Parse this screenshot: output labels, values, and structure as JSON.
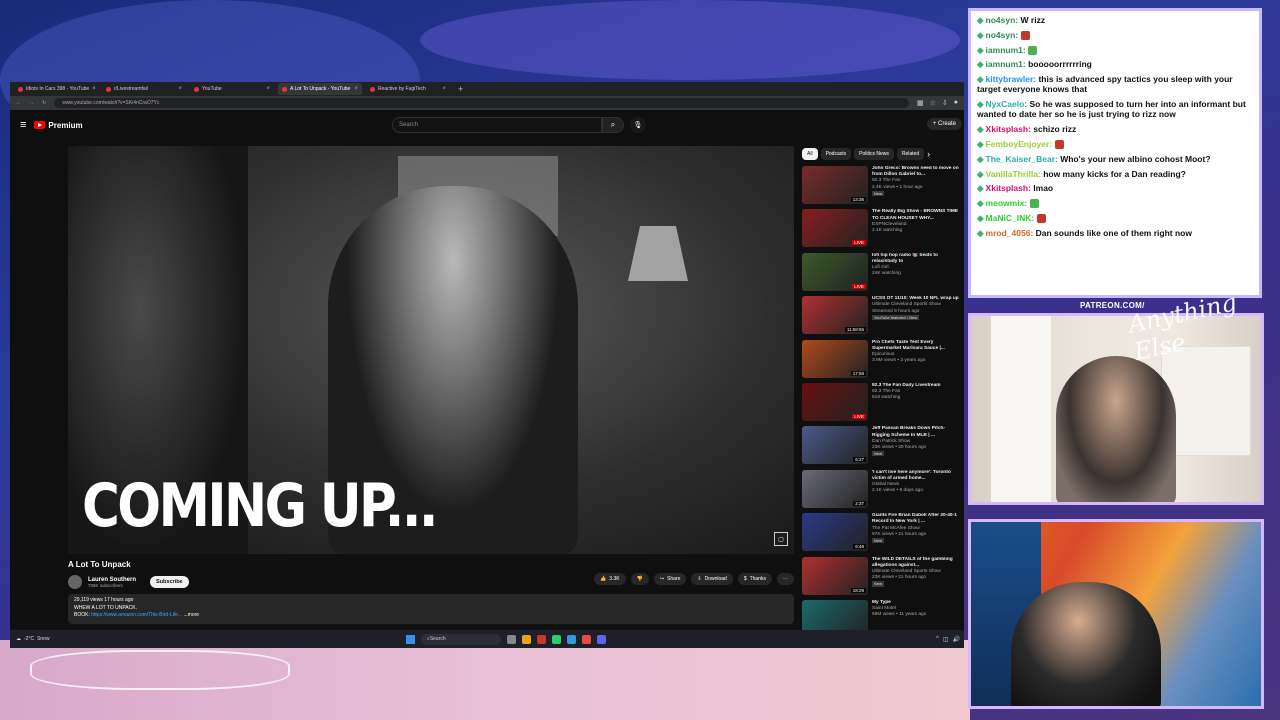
{
  "browser": {
    "tabs": [
      {
        "label": "Idiots In Cars 398 - YouTube",
        "active": false
      },
      {
        "label": "r/Livestreamfail",
        "active": false
      },
      {
        "label": "YouTube",
        "active": false
      },
      {
        "label": "A Lot To Unpack - YouTube",
        "active": true
      },
      {
        "label": "Reactive by FugiTech",
        "active": false
      }
    ],
    "url": "www.youtube.com/watch?v=SKi4nCraO7Yc"
  },
  "youtube": {
    "logo_label": "Premium",
    "search_placeholder": "Search",
    "create_label": "Create",
    "video_overlay_text": "COMING UP...",
    "title": "A Lot To Unpack",
    "channel": "Lauren Southern",
    "subscribers": "708K subscribers",
    "subscribe_label": "Subscribe",
    "likes": "3.3K",
    "share_label": "Share",
    "download_label": "Download",
    "thanks_label": "Thanks",
    "description": {
      "stats": "29,119 views  17 hours ago",
      "line1": "WHEW A LOT TO UNPACK.",
      "book_prefix": "BOOK: ",
      "book_link": "https://www.amazon.com/This-Bird-Life...",
      "more": "...more"
    },
    "chips": [
      "All",
      "Podcasts",
      "Politics News",
      "Related"
    ],
    "recommendations": [
      {
        "title": "John Greco: Browns need to move on from Dillon Gabriel to...",
        "channel": "92.3 The Fan",
        "views": "2.4K views • 1 hour ago",
        "badge": "New",
        "time": "13:36",
        "color": "#7a2a2a"
      },
      {
        "title": "The Really Big Show - BROWNS TIME TO CLEAN HOUSE? WHY...",
        "channel": "ESPNCleveland",
        "views": "2.1K watching",
        "badge": "",
        "time": "LIVE",
        "color": "#8a1e1e"
      },
      {
        "title": "lofi hip hop radio 📚 beats to relax/study to",
        "channel": "Lofi Girl",
        "views": "24K watching",
        "badge": "",
        "time": "LIVE",
        "color": "#3a5a2a"
      },
      {
        "title": "UCSS OT 11/10: Week 10 NFL wrap up",
        "channel": "Ultimate Cleveland Sports Show",
        "views": "Streamed 9 hours ago",
        "badge": "YouTube featured  •  New",
        "time": "11:58:55",
        "color": "#b03030"
      },
      {
        "title": "Pro Chefs Taste Test Every Supermarket Marinara Sauce |...",
        "channel": "Epicurious",
        "views": "3.9M views • 3 years ago",
        "badge": "",
        "time": "17:58",
        "color": "#b04a1a"
      },
      {
        "title": "92.3 The Fan Daily Livestream",
        "channel": "92.3 The Fan",
        "views": "518 watching",
        "badge": "",
        "time": "LIVE",
        "color": "#6a0f0f"
      },
      {
        "title": "Jeff Passan Breaks Down Pitch-Rigging Scheme In MLB | ...",
        "channel": "Dan Patrick Show",
        "views": "23K views • 20 hours ago",
        "badge": "New",
        "time": "6:27",
        "color": "#4a5a8a"
      },
      {
        "title": "'I can't live here anymore': Toronto victim of armed home...",
        "channel": "Global News",
        "views": "2.1K views • 6 days ago",
        "badge": "",
        "time": "2:37",
        "color": "#6a6a7a"
      },
      {
        "title": "Giants Fire Brian Daboll After 20-40-1 Record In New York | ...",
        "channel": "The Pat McAfee Show",
        "views": "97K views • 21 hours ago",
        "badge": "New",
        "time": "6:48",
        "color": "#2a3a8a"
      },
      {
        "title": "The WILD DETAILS of the gambling allegations against...",
        "channel": "Ultimate Cleveland Sports Show",
        "views": "23K views • 21 hours ago",
        "badge": "New",
        "time": "18:29",
        "color": "#b03030"
      },
      {
        "title": "My Type",
        "channel": "Saint Motel",
        "views": "58M views • 11 years ago",
        "badge": "",
        "time": "3:27",
        "color": "#1a6a6a"
      }
    ]
  },
  "taskbar": {
    "weather_temp": "-2°C",
    "weather_desc": "Snow",
    "search_label": "Search"
  },
  "chat": {
    "messages": [
      {
        "user": "no4syn:",
        "text": "W rizz",
        "color": "#2e8b57"
      },
      {
        "user": "no4syn:",
        "text": "",
        "color": "#2e8b57",
        "emote": "#c0392b"
      },
      {
        "user": "iamnum1:",
        "text": "",
        "color": "#2e8b57",
        "emote": "#4caf50"
      },
      {
        "user": "iamnum1:",
        "text": "booooorrrrrring",
        "color": "#2e8b57"
      },
      {
        "user": "kittybrawler:",
        "text": "this is advanced spy tactics you sleep with your target everyone knows that",
        "color": "#1e90ff"
      },
      {
        "user": "NyxCaelo:",
        "text": "So he was supposed to turn her into an informant but wanted to date her so he is just trying to rizz now",
        "color": "#20b2aa"
      },
      {
        "user": "Xkitsplash:",
        "text": "schizo rizz",
        "color": "#d2106a"
      },
      {
        "user": "FemboyEnjoyer:",
        "text": "",
        "color": "#9acd32",
        "emote": "#c0392b"
      },
      {
        "user": "The_Kaiser_Bear:",
        "text": "Who's your new albino cohost Moot?",
        "color": "#20b2aa"
      },
      {
        "user": "VanillaThrilla:",
        "text": "how many kicks for a Dan reading?",
        "color": "#9acd32"
      },
      {
        "user": "Xkitsplash:",
        "text": "lmao",
        "color": "#d2106a"
      },
      {
        "user": "meowmix:",
        "text": "",
        "color": "#32cd32",
        "emote": "#4caf50"
      },
      {
        "user": "MaNiC_INK:",
        "text": "",
        "color": "#32cd32",
        "emote": "#c0392b"
      },
      {
        "user": "mrod_4056:",
        "text": "Dan sounds like one of them right now",
        "color": "#d2691e"
      }
    ]
  },
  "overlay": {
    "patreon": "PATREON.COM/",
    "signature": "Anything Else"
  }
}
